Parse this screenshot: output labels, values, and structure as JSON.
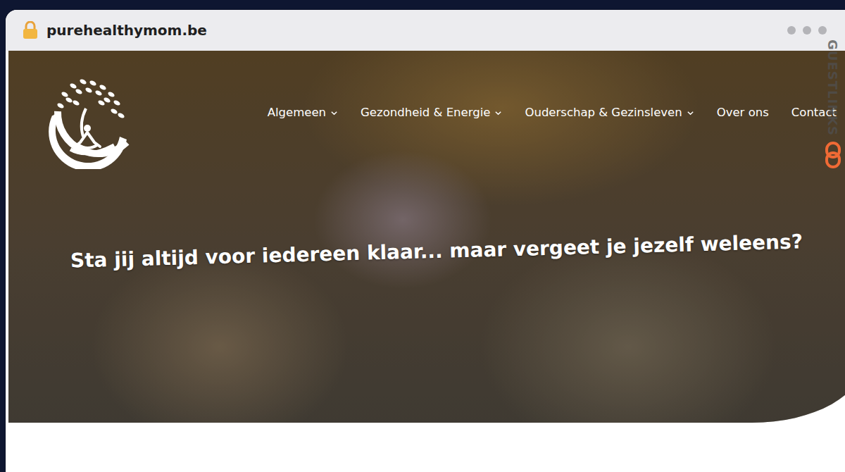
{
  "window": {
    "url": "purehealthymom.be"
  },
  "nav": [
    {
      "label": "Algemeen",
      "dropdown": true
    },
    {
      "label": "Gezondheid & Energie",
      "dropdown": true
    },
    {
      "label": "Ouderschap & Gezinsleven",
      "dropdown": true
    },
    {
      "label": "Over ons",
      "dropdown": false
    },
    {
      "label": "Contact",
      "dropdown": false
    }
  ],
  "hero": {
    "headline": "Sta jij altijd voor iedereen klaar... maar vergeet je jezelf weleens?"
  },
  "watermark": {
    "text": "GUESTLINKS"
  }
}
